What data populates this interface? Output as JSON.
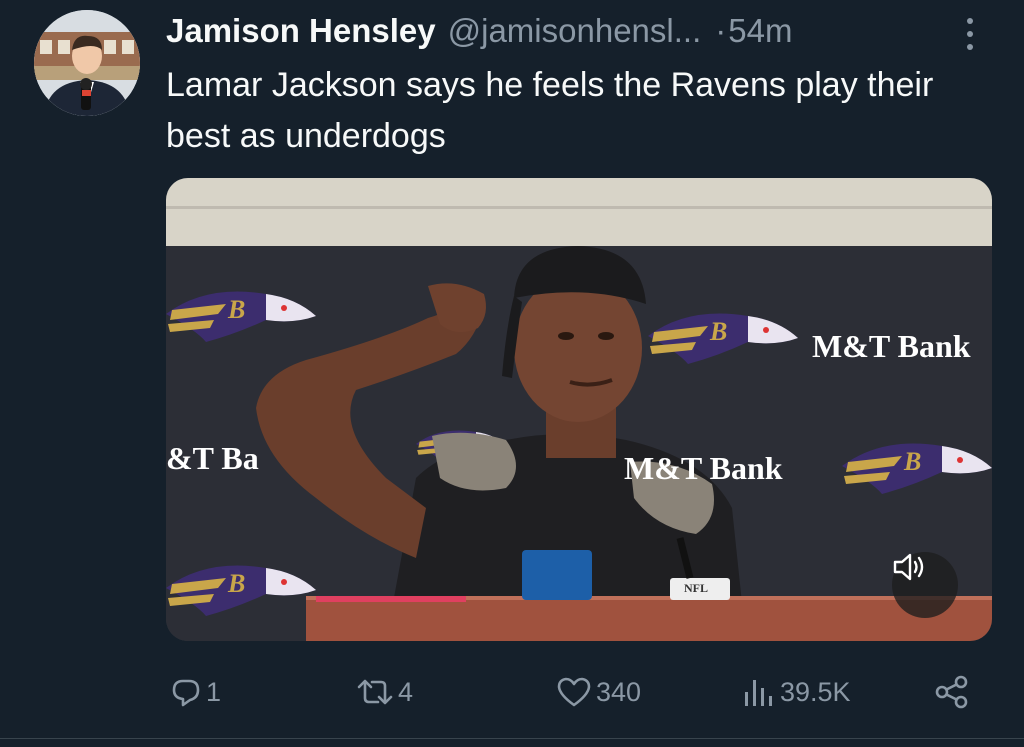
{
  "tweet": {
    "author": {
      "display_name": "Jamison Hensley",
      "handle": "@jamisonhensl...",
      "avatar_icon": "profile-photo"
    },
    "separator": "·",
    "timestamp": "54m",
    "text": "Lamar Jackson says he feels the Ravens play their best as underdogs",
    "media": {
      "type": "video",
      "sponsor_text": [
        "M&T Bank",
        "M&T Bank",
        "&T Ba"
      ],
      "mic_flag_text": "NFL",
      "mute_icon": "speaker-muted-icon"
    },
    "actions": {
      "reply": {
        "icon": "reply-icon",
        "count": "1"
      },
      "retweet": {
        "icon": "retweet-icon",
        "count": "4"
      },
      "like": {
        "icon": "heart-icon",
        "count": "340"
      },
      "views": {
        "icon": "views-icon",
        "count": "39.5K"
      },
      "share": {
        "icon": "share-icon"
      }
    }
  },
  "colors": {
    "background": "#15202b",
    "primary_text": "#f7f9f9",
    "secondary_text": "#8b98a5",
    "divider": "#38444d"
  }
}
